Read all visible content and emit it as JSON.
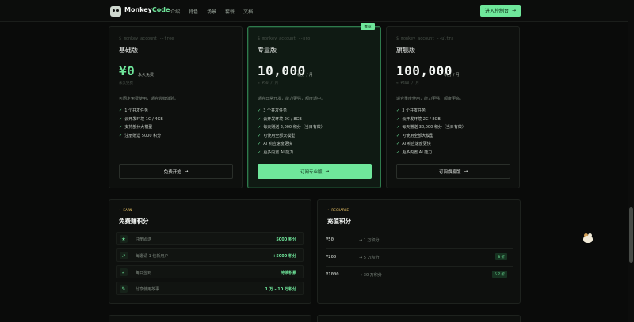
{
  "nav": {
    "brand_main": "Monkey",
    "brand_accent": "Code",
    "links": [
      "介绍",
      "特色",
      "场景",
      "套餐",
      "文档"
    ],
    "cta_label": "进入控制台",
    "cta_arrow": "→"
  },
  "plans": [
    {
      "code": "$ monkey account --free",
      "name": "基础版",
      "price": "¥0",
      "unit": "永久免费",
      "sub": "永久免费",
      "desc": "可固定免费使用，适合尝鲜体验。",
      "features": [
        "1 个并发任务",
        "云开发环境 1C / 4GB",
        "支持部分大模型",
        "注册赠送 5000 积分"
      ],
      "button": "免费开始",
      "featured": false
    },
    {
      "code": "$ monkey account --pro",
      "name": "专业版",
      "price": "10,000",
      "unit": "积分 / 月",
      "sub": "≈ ¥50 / 月",
      "desc": "适合日常开发，能力更强，额度适中。",
      "features": [
        "3 个并发任务",
        "云开发环境 2C / 8GB",
        "每天赠送 2,000 积分（当日有效）",
        "可使用全部大模型",
        "AI 响应速度更快",
        "更多内置 AI 能力"
      ],
      "button": "订阅专业版",
      "badge": "推荐",
      "featured": true
    },
    {
      "code": "$ monkey account --ultra",
      "name": "旗舰版",
      "price": "100,000",
      "unit": "积分 / 月",
      "sub": "≈ ¥400 / 月",
      "desc": "适合重度使用，能力更强，额度更高。",
      "features": [
        "3 个并发任务",
        "云开发环境 2C / 8GB",
        "每天赠送 30,000 积分（当日有效）",
        "可使用全部大模型",
        "AI 响应速度更快",
        "更多内置 AI 能力"
      ],
      "button": "订阅旗舰版",
      "featured": false
    }
  ],
  "earn": {
    "tag": "• EARN",
    "title": "免费赚积分",
    "rows": [
      {
        "icon": "★",
        "label": "注册即送",
        "value": "5000 积分"
      },
      {
        "icon": "↗",
        "label": "每邀请 1 位新用户",
        "value": "+5000 积分"
      },
      {
        "icon": "✓",
        "label": "每日签到",
        "value": "持续积累"
      },
      {
        "icon": "✎",
        "label": "分享使用故事",
        "value": "1 万 - 10 万积分"
      }
    ]
  },
  "recharge": {
    "tag": "• RECHARGE",
    "title": "充值积分",
    "rows": [
      {
        "price": "¥50",
        "points": "→ 1 万积分",
        "discount": ""
      },
      {
        "price": "¥200",
        "points": "→ 5 万积分",
        "discount": "8 折"
      },
      {
        "price": "¥1000",
        "points": "→ 30 万积分",
        "discount": "6.7 折"
      }
    ]
  },
  "check": "✓",
  "arrow": "→",
  "colors": {
    "accent": "#6fe79b",
    "tag": "#e9c264",
    "bg": "#0a0b0a"
  }
}
